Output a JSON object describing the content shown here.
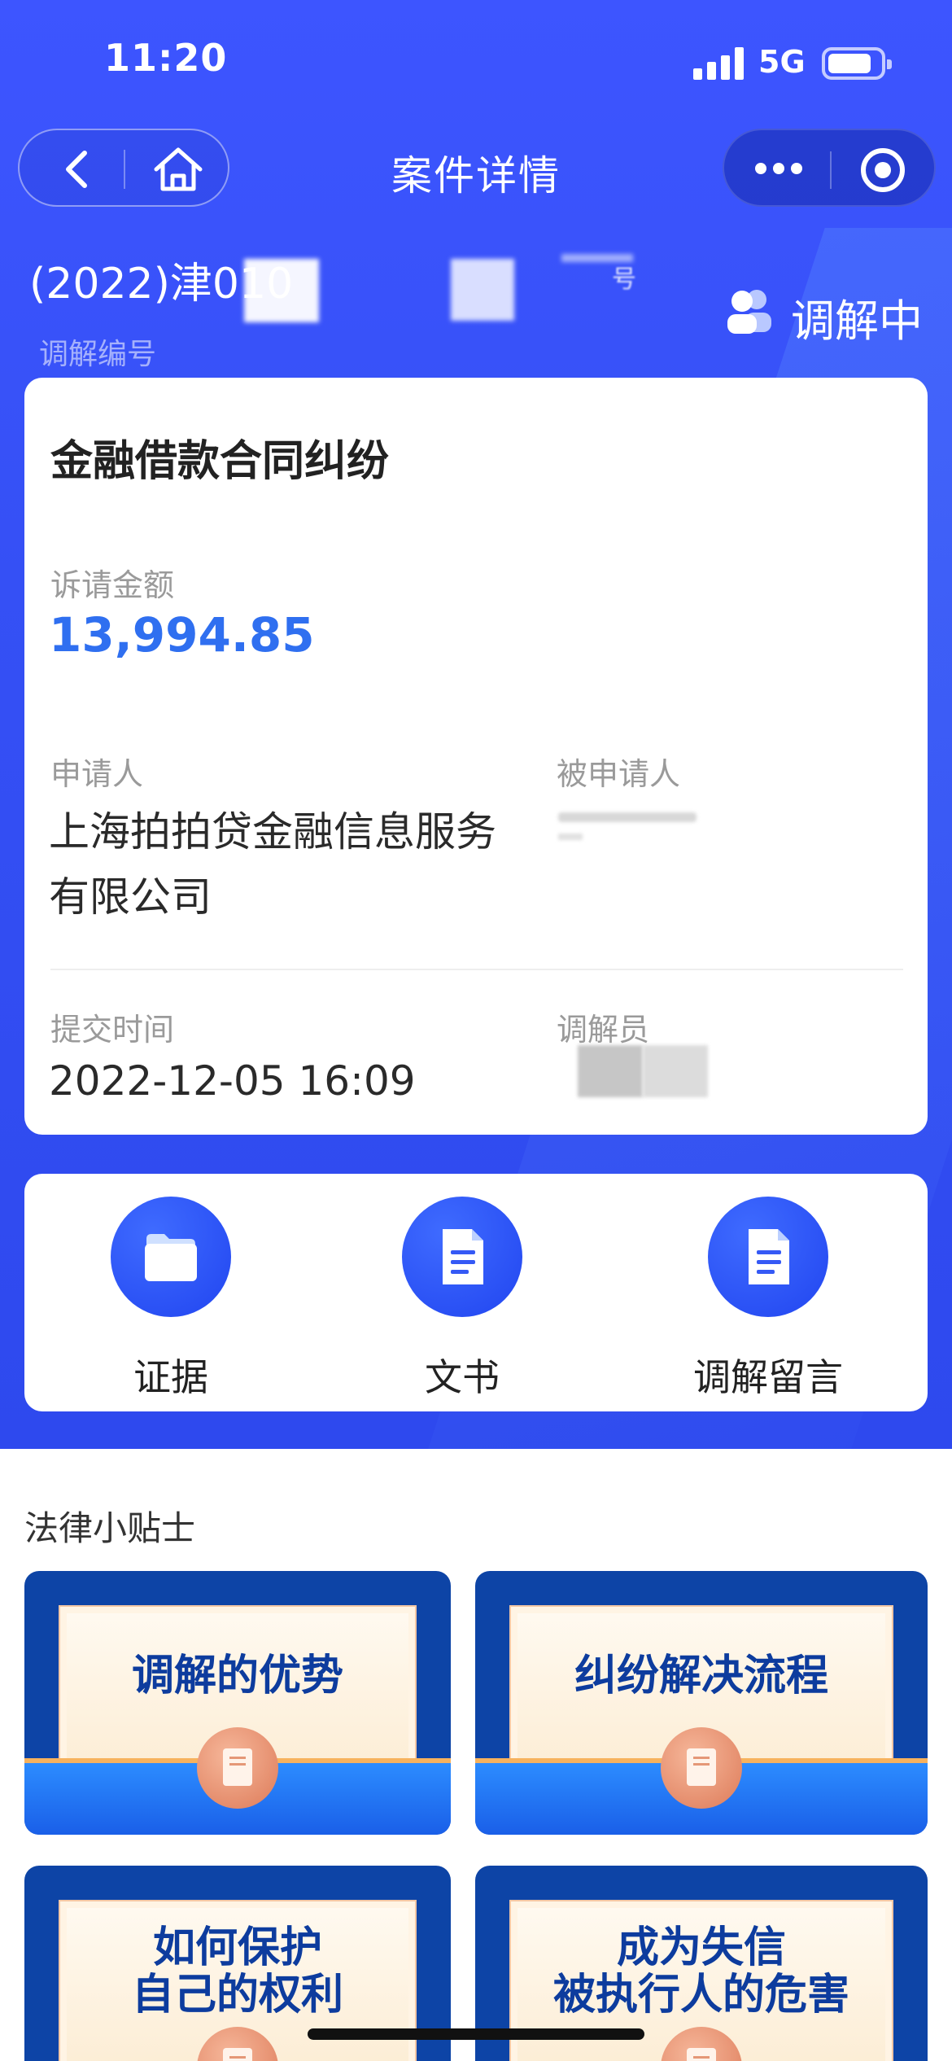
{
  "status_bar": {
    "time": "11:20",
    "network": "5G"
  },
  "nav": {
    "title": "案件详情"
  },
  "case": {
    "number_prefix": "(2022)津010",
    "number_suffix_fragment": "号",
    "number_label": "调解编号",
    "status": "调解中",
    "type": "金融借款合同纠纷",
    "amount_label": "诉请金额",
    "amount": "13,994.85",
    "applicant_label": "申请人",
    "applicant": "上海拍拍贷金融信息服务有限公司",
    "respondent_label": "被申请人",
    "submit_time_label": "提交时间",
    "submit_time": "2022-12-05 16:09",
    "mediator_label": "调解员"
  },
  "actions": [
    {
      "label": "证据",
      "icon": "folder-icon"
    },
    {
      "label": "文书",
      "icon": "document-icon"
    },
    {
      "label": "调解留言",
      "icon": "message-document-icon"
    }
  ],
  "tips": {
    "title": "法律小贴士",
    "items": [
      {
        "line1": "调解的优势",
        "line2": ""
      },
      {
        "line1": "纠纷解决流程",
        "line2": ""
      },
      {
        "line1": "如何保护",
        "line2": "自己的权利"
      },
      {
        "line1": "成为失信",
        "line2": "被执行人的危害"
      }
    ]
  },
  "colors": {
    "primary": "#3550f5",
    "amount": "#2f6ff0",
    "tip_bg": "#0d44a6"
  }
}
